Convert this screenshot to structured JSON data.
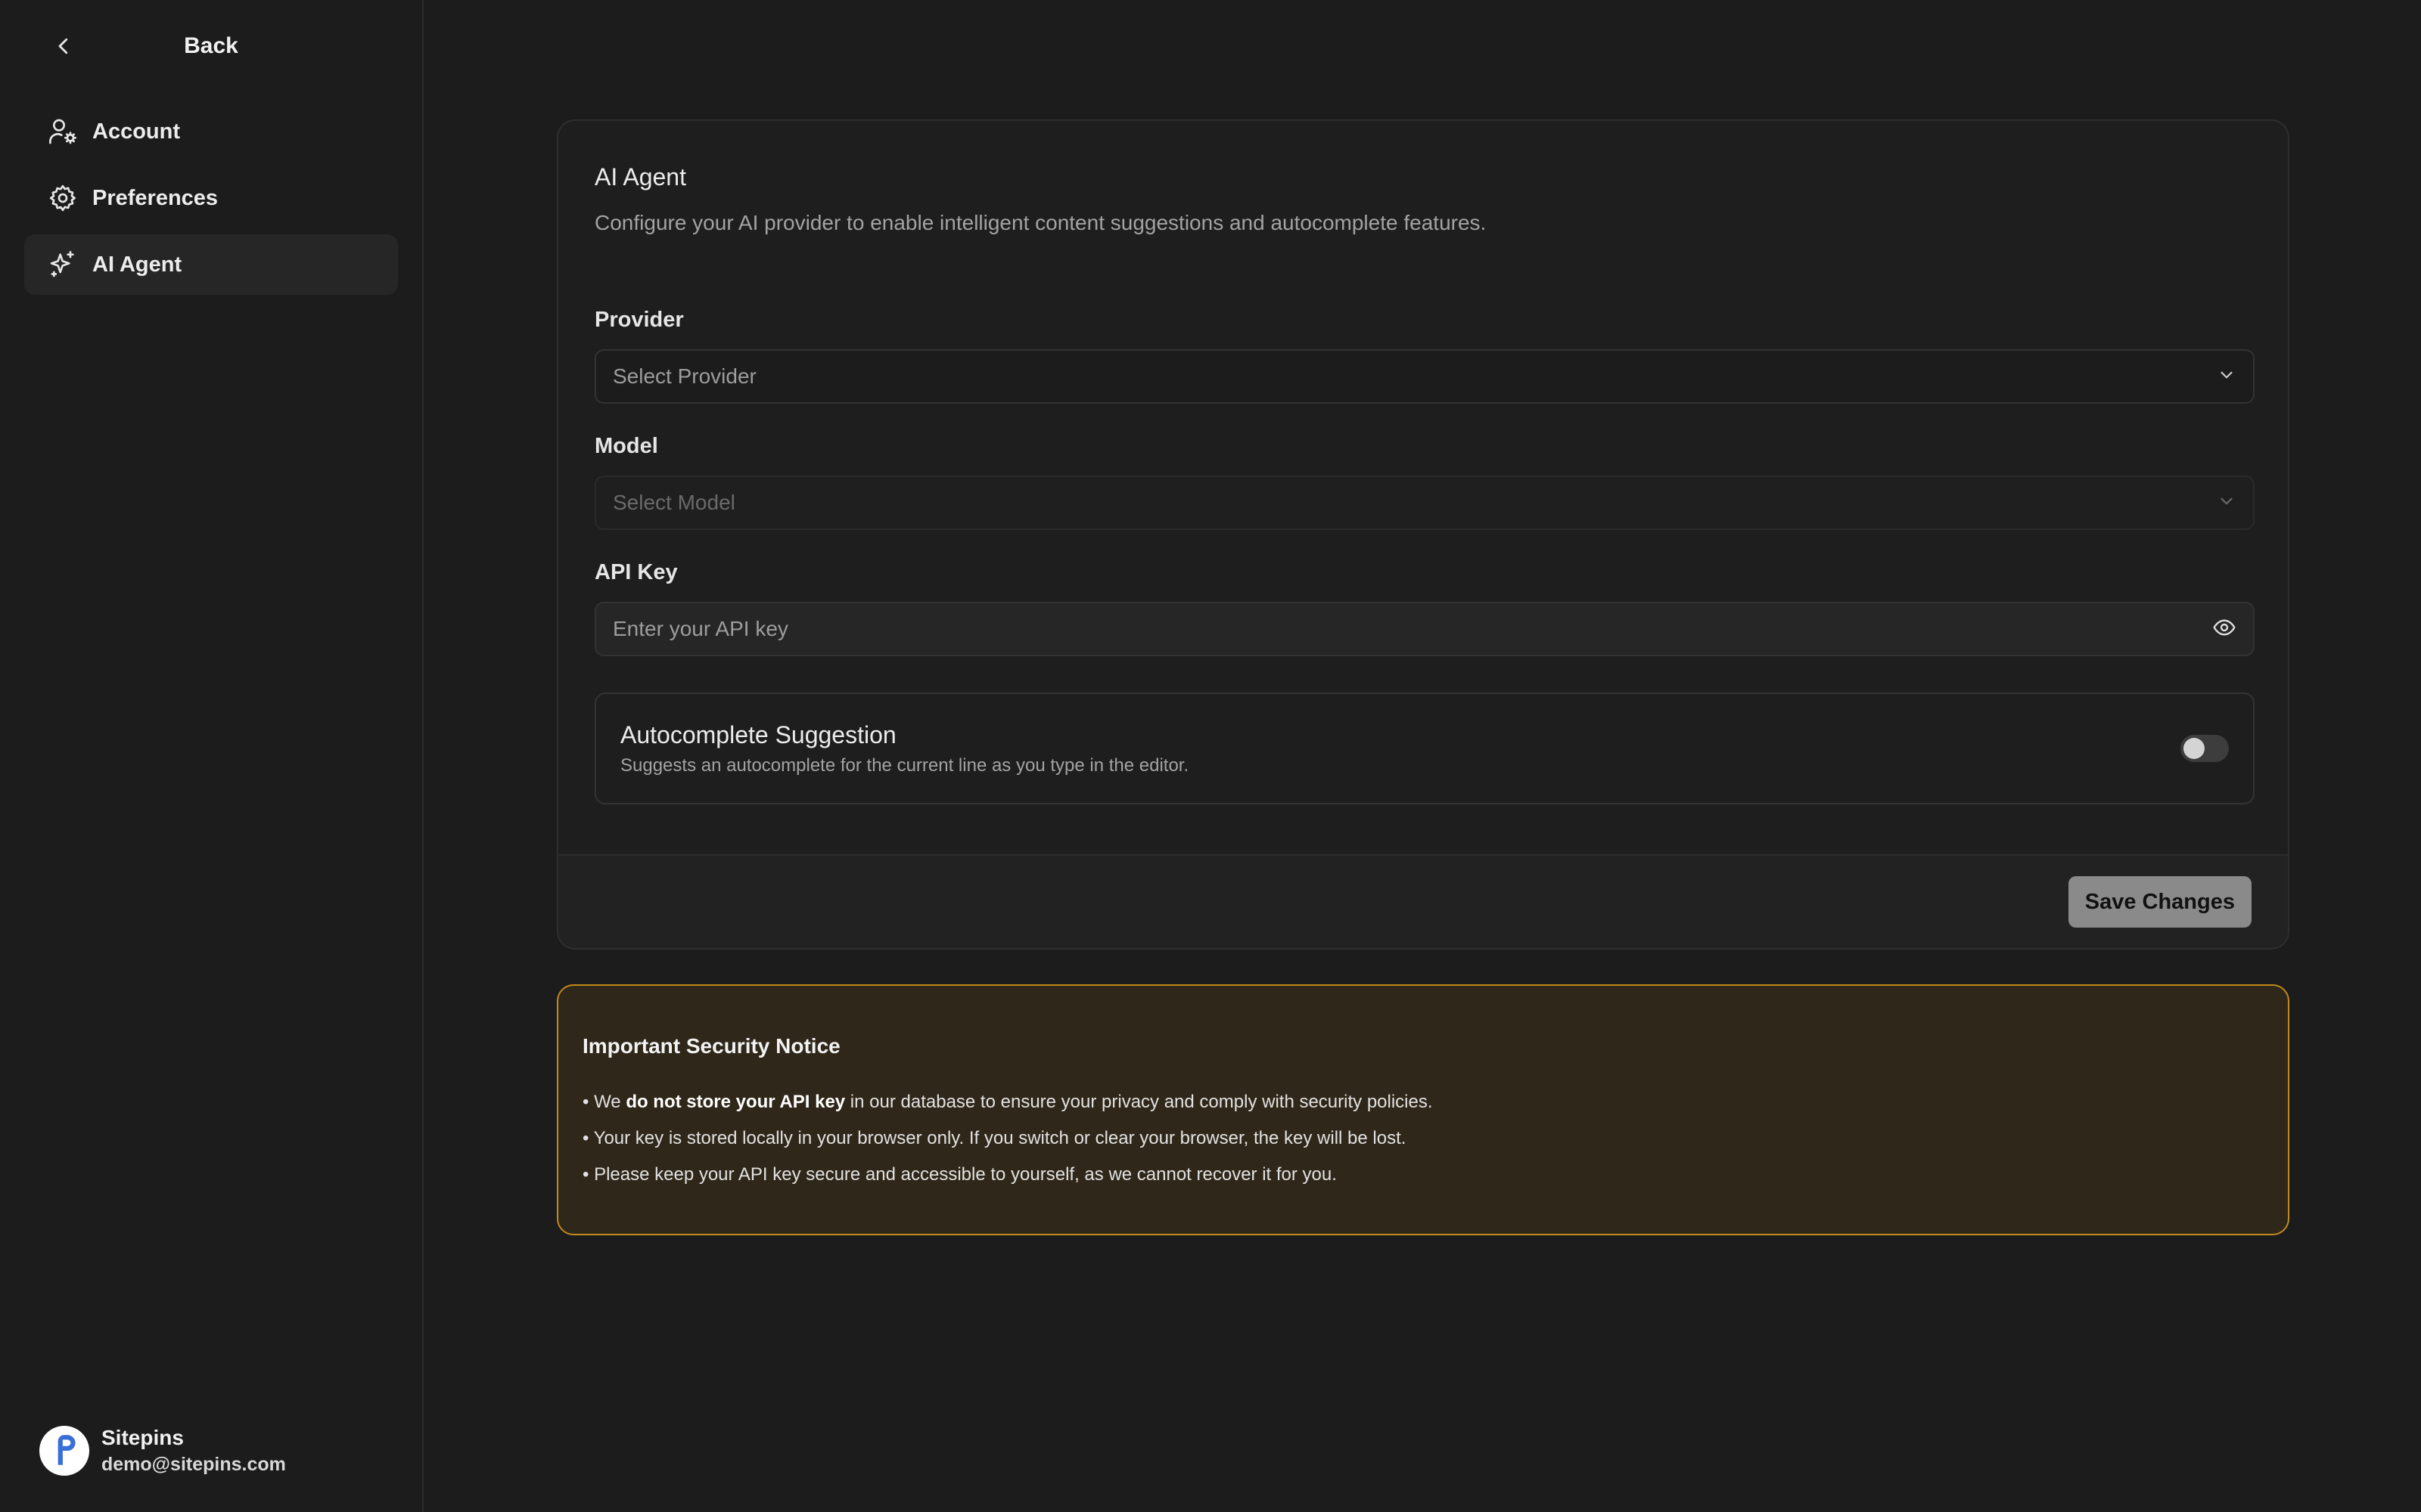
{
  "sidebar": {
    "back_label": "Back",
    "items": [
      {
        "label": "Account",
        "icon": "user-gear-icon"
      },
      {
        "label": "Preferences",
        "icon": "gear-icon"
      },
      {
        "label": "AI Agent",
        "icon": "sparkles-icon",
        "active": true
      }
    ],
    "user": {
      "name": "Sitepins",
      "email": "demo@sitepins.com"
    }
  },
  "card": {
    "title": "AI Agent",
    "description": "Configure your AI provider to enable intelligent content suggestions and autocomplete features.",
    "provider": {
      "label": "Provider",
      "placeholder": "Select Provider"
    },
    "model": {
      "label": "Model",
      "placeholder": "Select Model"
    },
    "api_key": {
      "label": "API Key",
      "placeholder": "Enter your API key"
    },
    "autocomplete": {
      "title": "Autocomplete Suggestion",
      "description": "Suggests an autocomplete for the current line as you type in the editor.",
      "enabled": false
    },
    "save_label": "Save Changes"
  },
  "notice": {
    "title": "Important Security Notice",
    "line1_pre": "• We ",
    "line1_bold": "do not store your API key",
    "line1_post": " in our database to ensure your privacy and comply with security policies.",
    "line2": "• Your key is stored locally in your browser only. If you switch or clear your browser, the key will be lost.",
    "line3": "• Please keep your API key secure and accessible to yourself, as we cannot recover it for you."
  },
  "colors": {
    "background": "#1c1c1c",
    "notice_border": "#c08a1c",
    "notice_bg": "#2f2719",
    "button": "#8a8a8a",
    "brand_logo": "#3b6fd8"
  }
}
